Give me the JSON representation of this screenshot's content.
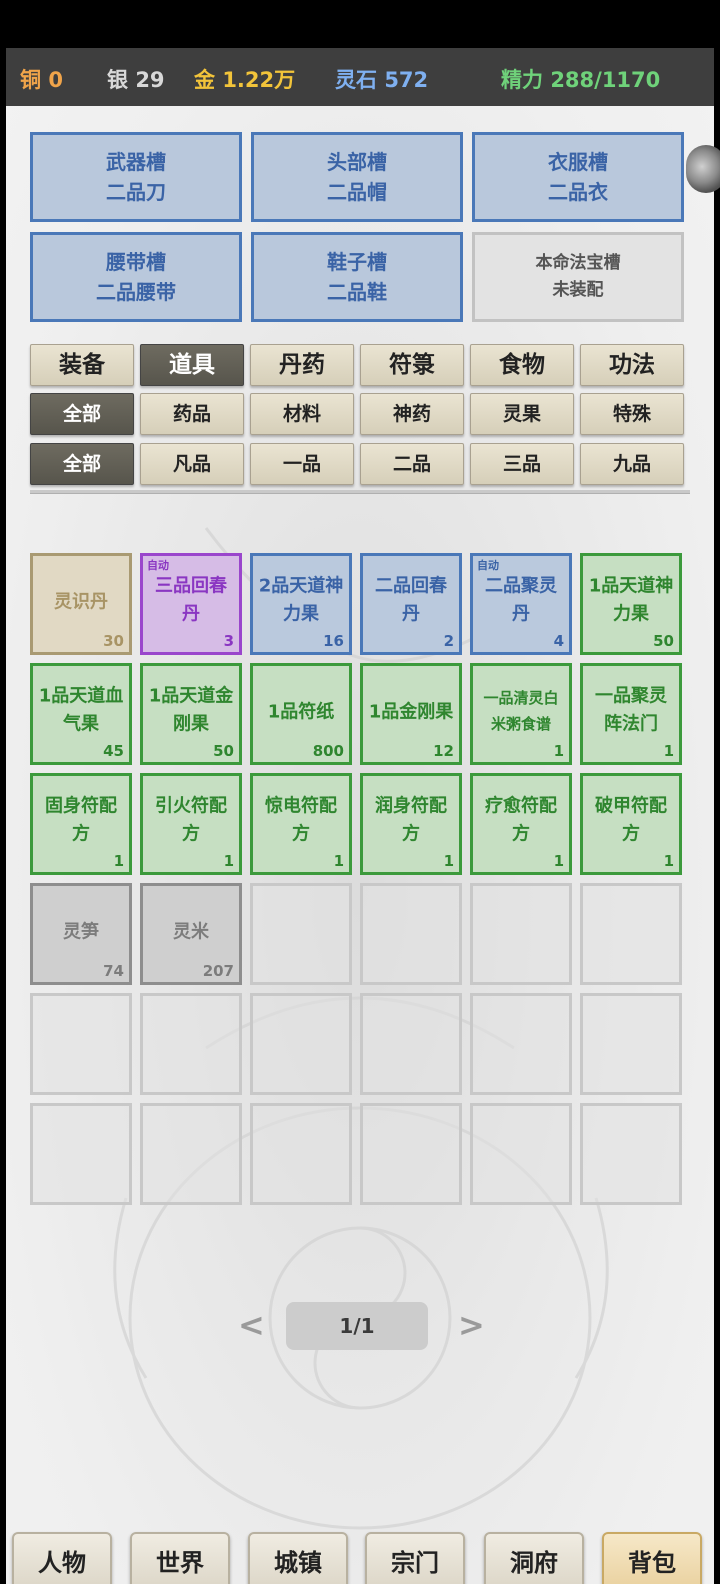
{
  "resources": {
    "copper": {
      "label": "铜",
      "value": "0",
      "color": "#f0a44a"
    },
    "silver": {
      "label": "银",
      "value": "29",
      "color": "#d8d8d8"
    },
    "gold": {
      "label": "金",
      "value": "1.22万",
      "color": "#f2c43a"
    },
    "spirit_stone": {
      "label": "灵石",
      "value": "572",
      "color": "#7fb0f0"
    },
    "energy": {
      "label": "精力",
      "value": "288/1170",
      "color": "#6fd27a"
    }
  },
  "equipment_slots": [
    {
      "slot": "武器槽",
      "item": "二品刀"
    },
    {
      "slot": "头部槽",
      "item": "二品帽"
    },
    {
      "slot": "衣服槽",
      "item": "二品衣"
    },
    {
      "slot": "腰带槽",
      "item": "二品腰带"
    },
    {
      "slot": "鞋子槽",
      "item": "二品鞋"
    },
    {
      "slot": "本命法宝槽",
      "item": "未装配"
    }
  ],
  "category_tabs": [
    "装备",
    "道具",
    "丹药",
    "符箓",
    "食物",
    "功法"
  ],
  "selected_category": "道具",
  "type_filters": [
    "全部",
    "药品",
    "材料",
    "神药",
    "灵果",
    "特殊"
  ],
  "selected_type": "全部",
  "grade_filters": [
    "全部",
    "凡品",
    "一品",
    "二品",
    "三品",
    "九品"
  ],
  "selected_grade": "全部",
  "auto_tag": "自动",
  "items": [
    {
      "name": "灵识丹",
      "count": "30",
      "quality": "tan"
    },
    {
      "name": "三品回春丹",
      "count": "3",
      "quality": "purple",
      "auto": true
    },
    {
      "name": "2品天道神力果",
      "count": "16",
      "quality": "blue"
    },
    {
      "name": "二品回春丹",
      "count": "2",
      "quality": "blue"
    },
    {
      "name": "二品聚灵丹",
      "count": "4",
      "quality": "blue",
      "auto": true
    },
    {
      "name": "1品天道神力果",
      "count": "50",
      "quality": "green"
    },
    {
      "name": "1品天道血气果",
      "count": "45",
      "quality": "green"
    },
    {
      "name": "1品天道金刚果",
      "count": "50",
      "quality": "green"
    },
    {
      "name": "1品符纸",
      "count": "800",
      "quality": "green"
    },
    {
      "name": "1品金刚果",
      "count": "12",
      "quality": "green"
    },
    {
      "name": "一品清灵白米粥食谱",
      "count": "1",
      "quality": "green"
    },
    {
      "name": "一品聚灵阵法门",
      "count": "1",
      "quality": "green"
    },
    {
      "name": "固身符配方",
      "count": "1",
      "quality": "green"
    },
    {
      "name": "引火符配方",
      "count": "1",
      "quality": "green"
    },
    {
      "name": "惊电符配方",
      "count": "1",
      "quality": "green"
    },
    {
      "name": "润身符配方",
      "count": "1",
      "quality": "green"
    },
    {
      "name": "疗愈符配方",
      "count": "1",
      "quality": "green"
    },
    {
      "name": "破甲符配方",
      "count": "1",
      "quality": "green"
    },
    {
      "name": "灵笋",
      "count": "74",
      "quality": "gray"
    },
    {
      "name": "灵米",
      "count": "207",
      "quality": "gray"
    }
  ],
  "pager": {
    "prev": "<",
    "page": "1/1",
    "next": ">"
  },
  "bottom_nav": [
    "人物",
    "世界",
    "城镇",
    "宗门",
    "洞府",
    "背包"
  ],
  "active_nav": "背包"
}
